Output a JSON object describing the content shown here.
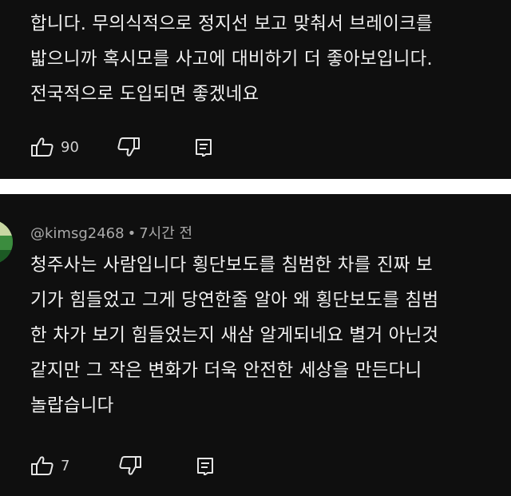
{
  "comment_1": {
    "lines": [
      "합니다. 무의식적으로 정지선 보고 맞춰서 브레이크를",
      "밟으니까 혹시모를 사고에 대비하기 더 좋아보입니다.",
      "전국적으로 도입되면 좋겠네요"
    ],
    "like_count": "90",
    "icons": {
      "like": "thumbs-up-icon",
      "dislike": "thumbs-down-icon",
      "reply": "reply-icon"
    }
  },
  "comment_2": {
    "author": "@kimsg2468",
    "separator": "•",
    "time": "7시간 전",
    "lines": [
      "청주사는 사람입니다 횡단보도를 침범한 차를 진짜 보",
      "기가 힘들었고 그게 당연한줄 알아 왜 횡단보도를 침범",
      "한 차가 보기 힘들었는지 새삼 알게되네요 별거 아닌것",
      "같지만 그 작은 변화가 더욱 안전한 세상을 만든다니",
      "놀랍습니다"
    ],
    "like_count": "7",
    "icons": {
      "avatar": "avatar",
      "like": "thumbs-up-icon",
      "dislike": "thumbs-down-icon",
      "reply": "reply-icon"
    }
  },
  "colors": {
    "background": "#0f0f0f",
    "separator": "#ffffff",
    "text": "#f1f1f1",
    "meta": "#aaaaaa"
  }
}
